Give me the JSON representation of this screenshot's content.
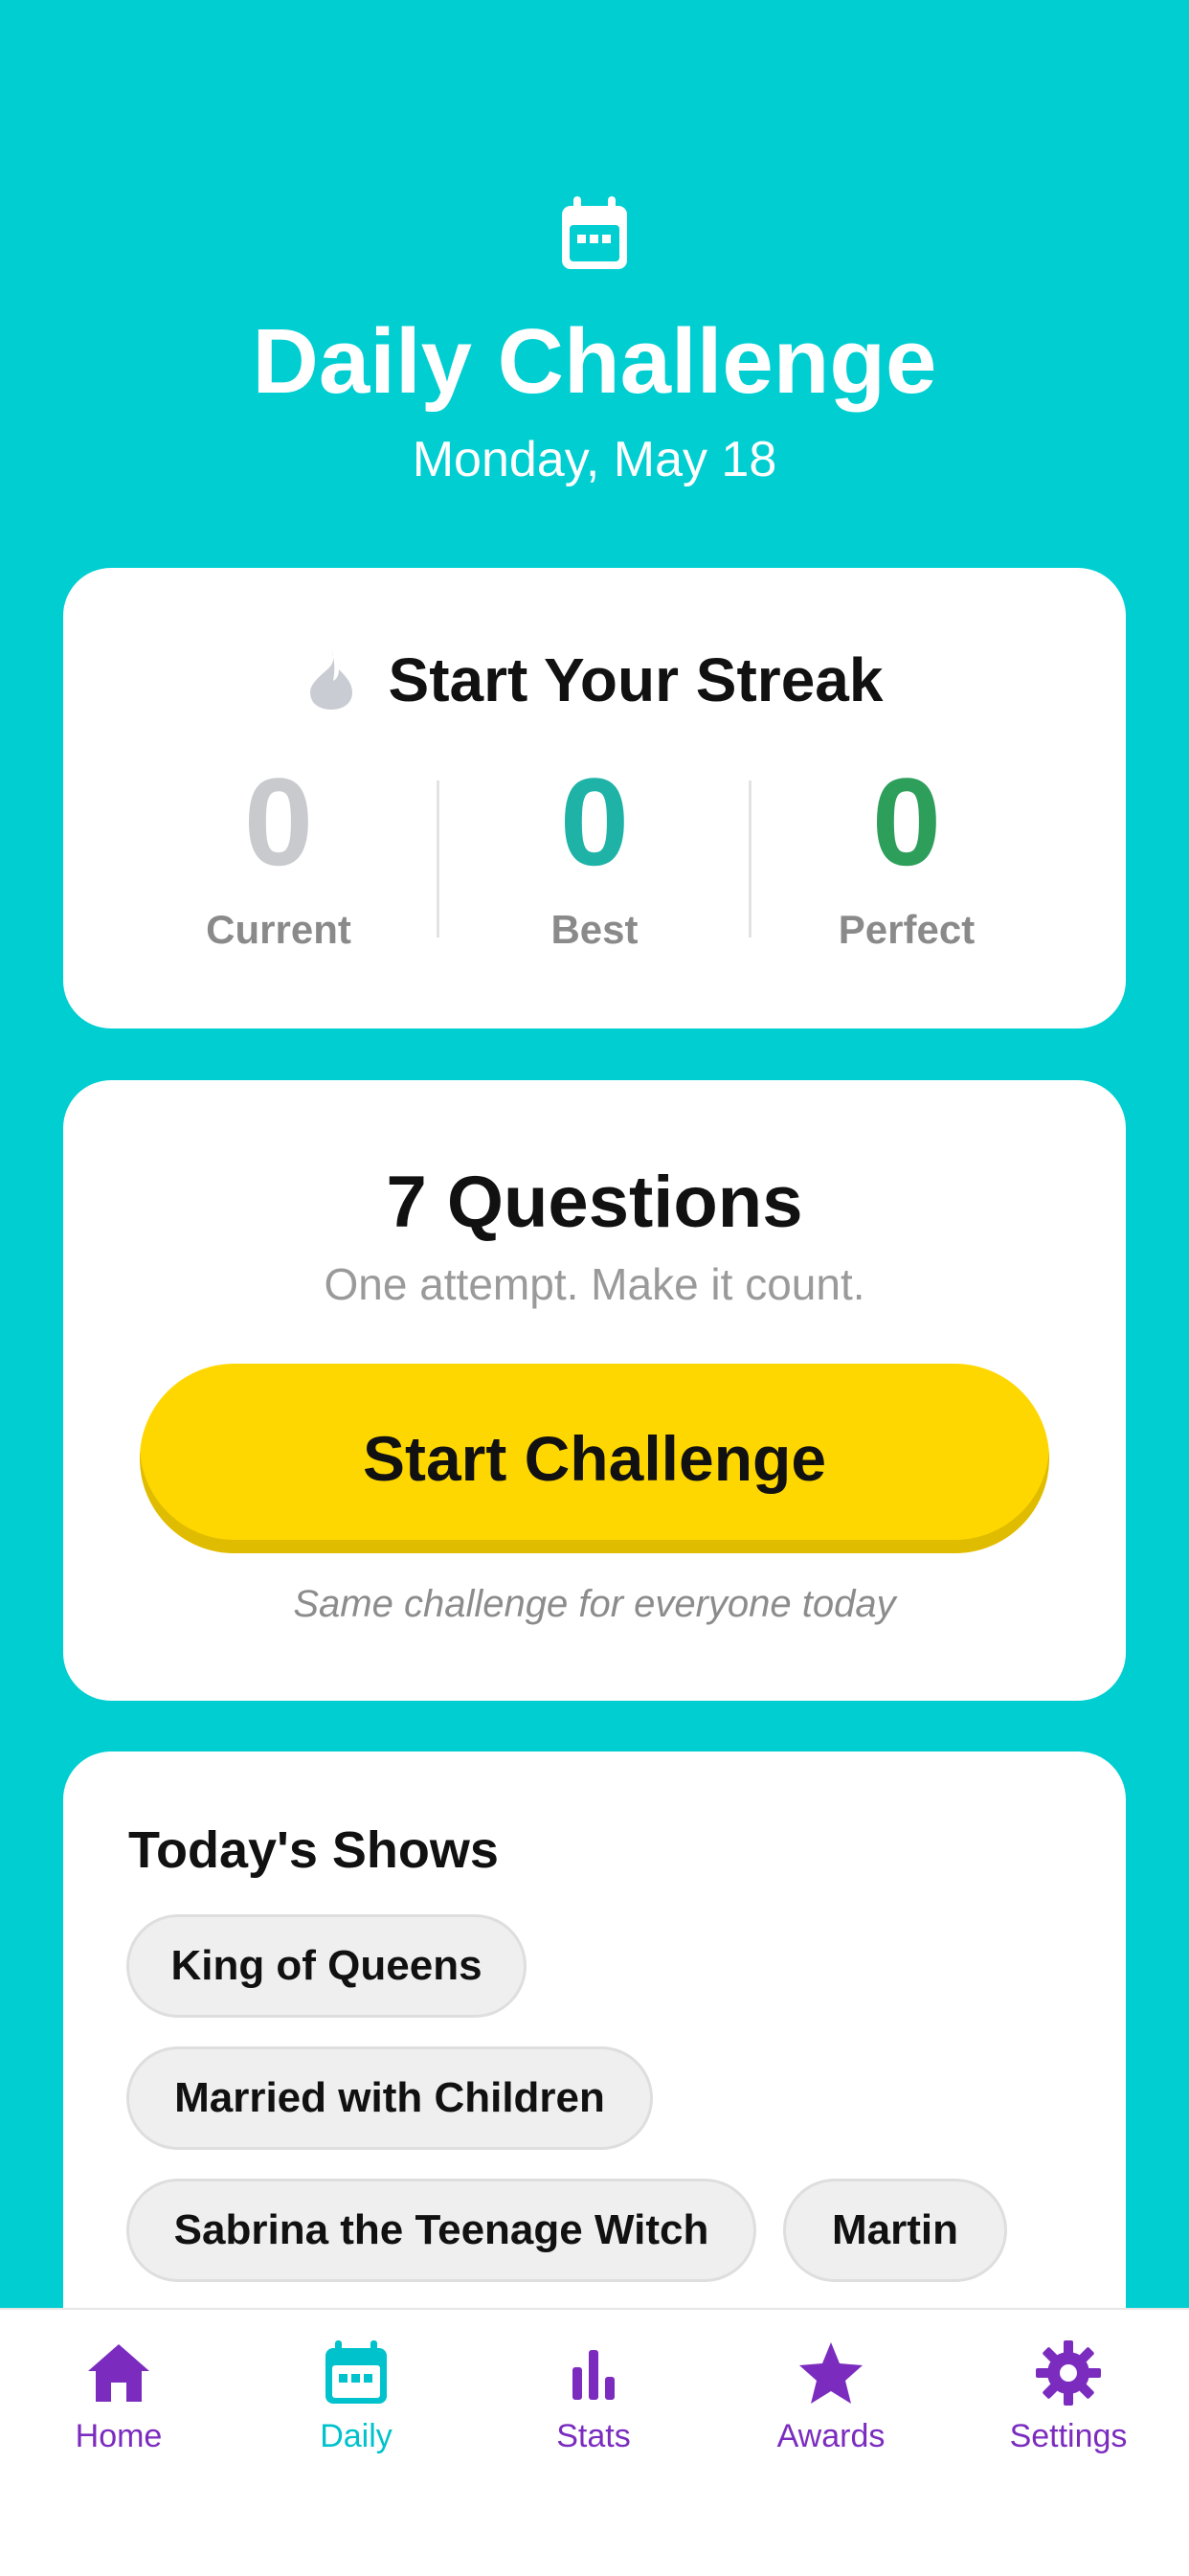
{
  "header": {
    "title": "Daily Challenge",
    "date": "Monday, May 18",
    "icon": "calendar-icon"
  },
  "streak": {
    "title": "Start Your Streak",
    "icon": "flame-icon",
    "stats": [
      {
        "value": "0",
        "label": "Current",
        "color": "#C8CACD"
      },
      {
        "value": "0",
        "label": "Best",
        "color": "#1FB3A8"
      },
      {
        "value": "0",
        "label": "Perfect",
        "color": "#2E9E5B"
      }
    ]
  },
  "challenge": {
    "title": "7 Questions",
    "subtitle": "One attempt. Make it count.",
    "button_label": "Start Challenge",
    "note": "Same challenge for everyone today"
  },
  "shows": {
    "title": "Today's Shows",
    "items": [
      "King of Queens",
      "Married with Children",
      "Sabrina the Teenage Witch",
      "Martin"
    ]
  },
  "tabbar": {
    "items": [
      {
        "label": "Home",
        "icon": "home-icon"
      },
      {
        "label": "Daily",
        "icon": "calendar-icon",
        "active": true
      },
      {
        "label": "Stats",
        "icon": "bar-chart-icon"
      },
      {
        "label": "Awards",
        "icon": "star-icon"
      },
      {
        "label": "Settings",
        "icon": "gear-icon"
      }
    ]
  },
  "colors": {
    "background": "#00CED1",
    "accent": "#FFD700",
    "tab_inactive": "#7B2CBF",
    "tab_active": "#00C2CC"
  }
}
